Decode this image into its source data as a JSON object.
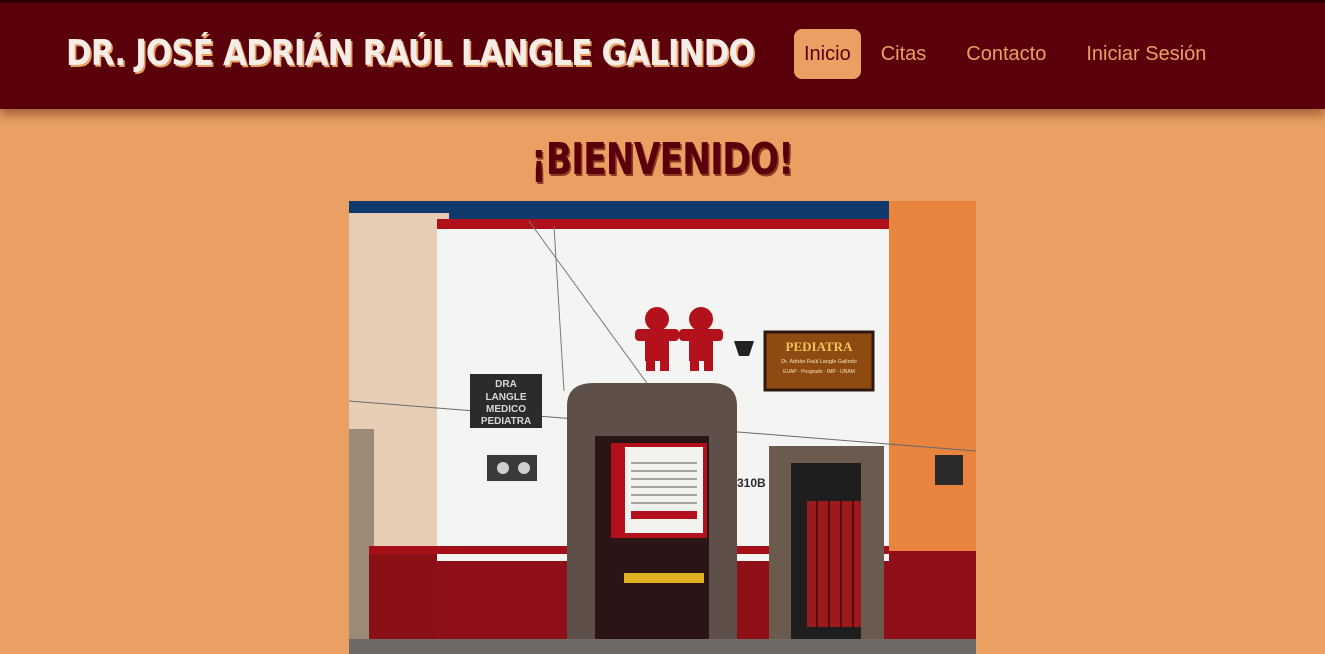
{
  "header": {
    "title": "DR. JOSÉ ADRIÁN RAÚL LANGLE GALINDO",
    "nav": [
      {
        "label": "Inicio",
        "active": true
      },
      {
        "label": "Citas",
        "active": false
      },
      {
        "label": "Contacto",
        "active": false
      },
      {
        "label": "Iniciar Sesión",
        "active": false
      }
    ]
  },
  "main": {
    "heading": "¡BIENVENIDO!",
    "photo": {
      "sign_title": "PEDIATRA",
      "sign_name": "Dr. Adrián Raúl Langle Galindo",
      "sign_sub": "EUAP · Posgrado · IMP · UNAM",
      "wall_sign_lines": [
        "DRA",
        "LANGLE",
        "MEDICO",
        "PEDIATRA"
      ],
      "street_number": "310B"
    }
  },
  "colors": {
    "header_bg": "#5A000B",
    "page_bg": "#E9A062",
    "accent": "#E9A062",
    "title_text": "#F6EEE6"
  }
}
